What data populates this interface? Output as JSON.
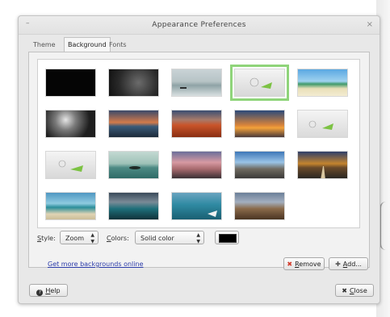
{
  "window": {
    "title": "Appearance Preferences",
    "menu_glyph": "–",
    "close_glyph": "×"
  },
  "tabs": [
    {
      "label": "Theme",
      "active": false
    },
    {
      "label": "Background",
      "active": true
    },
    {
      "label": "Fonts",
      "active": false
    }
  ],
  "wallpapers": {
    "selected_index": 3,
    "count": 19,
    "items": [
      "wallpaper-black-solid",
      "wallpaper-dark-rock-texture",
      "wallpaper-lake-boat",
      "wallpaper-green-fish-toy",
      "wallpaper-tropical-beach",
      "wallpaper-monochrome-abstract",
      "wallpaper-sunset-coast",
      "wallpaper-autumn-field",
      "wallpaper-orange-sunset",
      "wallpaper-green-fish-toy-2",
      "wallpaper-green-fish-toy-3",
      "wallpaper-island-sea",
      "wallpaper-pink-sky-rocks",
      "wallpaper-city-road",
      "wallpaper-desert-road",
      "wallpaper-teal-beach",
      "wallpaper-stormy-sea",
      "wallpaper-teal-boat",
      "wallpaper-rocky-hills"
    ]
  },
  "style": {
    "label_prefix": "S",
    "label_rest": "tyle:",
    "value": "Zoom"
  },
  "colors": {
    "label_prefix": "C",
    "label_rest": "olors:",
    "value": "Solid color",
    "swatch_color": "#000000"
  },
  "link": {
    "label": "Get more backgrounds online"
  },
  "buttons": {
    "remove_prefix": "R",
    "remove_rest": "emove",
    "add_prefix": "A",
    "add_rest": "dd...",
    "help_prefix": "H",
    "help_rest": "elp",
    "close_prefix": "C",
    "close_rest": "lose"
  },
  "icons": {
    "remove": "x-icon",
    "add": "plus-icon",
    "help": "help-icon",
    "close": "close-icon",
    "spinner": "up-down-arrows-icon"
  },
  "colors_theme": {
    "selection_outline": "#8fd47a",
    "link": "#2a3aa8",
    "remove_icon": "#d23a2a"
  }
}
